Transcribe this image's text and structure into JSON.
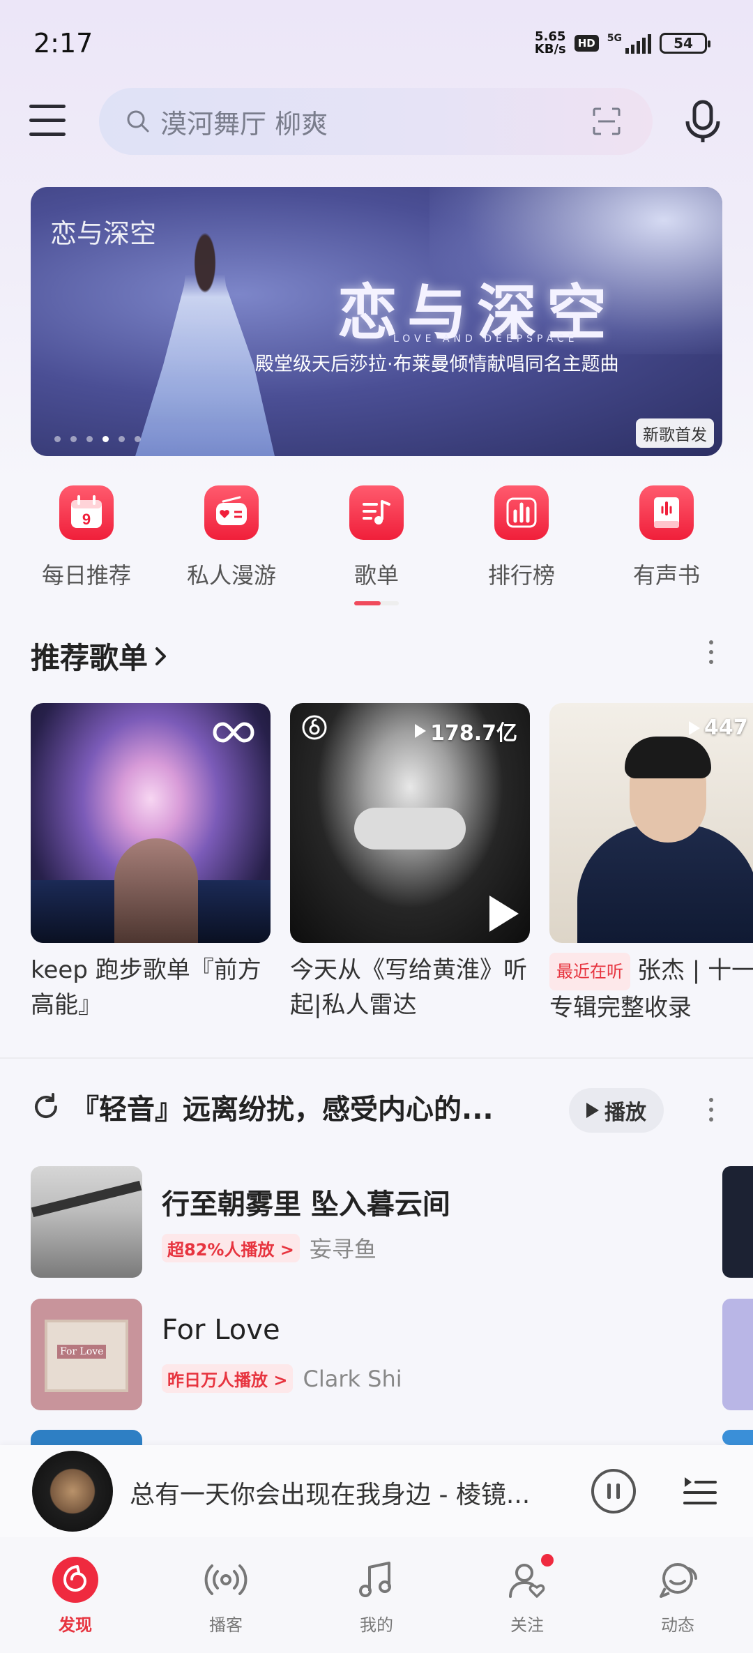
{
  "status_bar": {
    "time": "2:17",
    "net_speed_value": "5.65",
    "net_speed_unit": "KB/s",
    "hd": "HD",
    "network": "5G",
    "battery": "54"
  },
  "search": {
    "placeholder": "漠河舞厅 柳爽"
  },
  "banner": {
    "logo_text": "恋与深空",
    "headline": "恋与深空",
    "english": "LOVE AND DEEPSPACE",
    "subtitle": "殿堂级天后莎拉·布莱曼倾情献唱同名主题曲",
    "badge": "新歌首发"
  },
  "quick_entries": [
    {
      "label": "每日推荐",
      "icon": "calendar-icon",
      "number": "9"
    },
    {
      "label": "私人漫游",
      "icon": "radio-icon"
    },
    {
      "label": "歌单",
      "icon": "playlist-icon"
    },
    {
      "label": "排行榜",
      "icon": "chart-icon"
    },
    {
      "label": "有声书",
      "icon": "audiobook-icon"
    }
  ],
  "recommended": {
    "title": "推荐歌单",
    "cards": [
      {
        "title": "keep 跑步歌单『前方高能』",
        "play_count": ""
      },
      {
        "title": "今天从《写给黄淮》听起|私人雷达",
        "play_count": "178.7亿"
      },
      {
        "tag": "最近在听",
        "title": "张杰 | 十一专辑完整收录",
        "play_count": "447"
      }
    ]
  },
  "mix_section": {
    "title": "『轻音』远离纷扰，感受内心的...",
    "play_label": "播放",
    "songs": [
      {
        "name": "行至朝雾里 坠入暮云间",
        "hot": "超82%人播放 >",
        "artist": "妄寻鱼"
      },
      {
        "name": "For Love",
        "hot": "昨日万人播放 >",
        "artist": "Clark Shi",
        "cover_text": "For Love"
      }
    ]
  },
  "mini_player": {
    "now_playing": "总有一天你会出现在我身边 - 棱镜..."
  },
  "bottom_nav": [
    {
      "label": "发现",
      "icon": "netease-logo-icon",
      "active": true
    },
    {
      "label": "播客",
      "icon": "podcast-icon"
    },
    {
      "label": "我的",
      "icon": "music-note-icon"
    },
    {
      "label": "关注",
      "icon": "follow-icon"
    },
    {
      "label": "动态",
      "icon": "moments-icon"
    }
  ],
  "colors": {
    "accent": "#f01f3a",
    "background": "#f6f6fb"
  }
}
